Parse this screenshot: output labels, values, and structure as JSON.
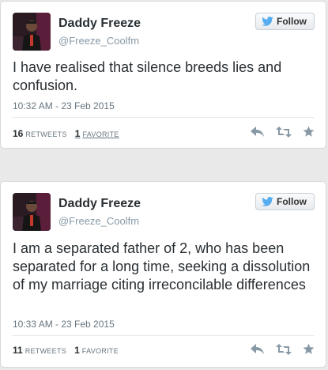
{
  "colors": {
    "twitter_blue": "#55acee",
    "text": "#292f33",
    "muted": "#8899a6",
    "action_icon": "#8899a6"
  },
  "tweets": [
    {
      "user": {
        "name": "Daddy Freeze",
        "handle": "@Freeze_Coolfm"
      },
      "follow_label": "Follow",
      "text": "I have realised that silence breeds lies and confusion.",
      "timestamp": "10:32 AM - 23 Feb 2015",
      "retweets": {
        "count": "16",
        "label": "RETWEETS"
      },
      "favorites": {
        "count": "1",
        "label": "FAVORITE"
      },
      "icons": [
        "reply-icon",
        "retweet-icon",
        "favorite-star-icon"
      ]
    },
    {
      "user": {
        "name": "Daddy Freeze",
        "handle": "@Freeze_Coolfm"
      },
      "follow_label": "Follow",
      "text": "I am a separated father of 2, who has been separated for a long time, seeking a dissolution of my marriage citing irreconcilable differences",
      "timestamp": "10:33 AM - 23 Feb 2015",
      "retweets": {
        "count": "11",
        "label": "RETWEETS"
      },
      "favorites": {
        "count": "1",
        "label": "FAVORITE"
      },
      "icons": [
        "reply-icon",
        "retweet-icon",
        "favorite-star-icon"
      ]
    }
  ]
}
